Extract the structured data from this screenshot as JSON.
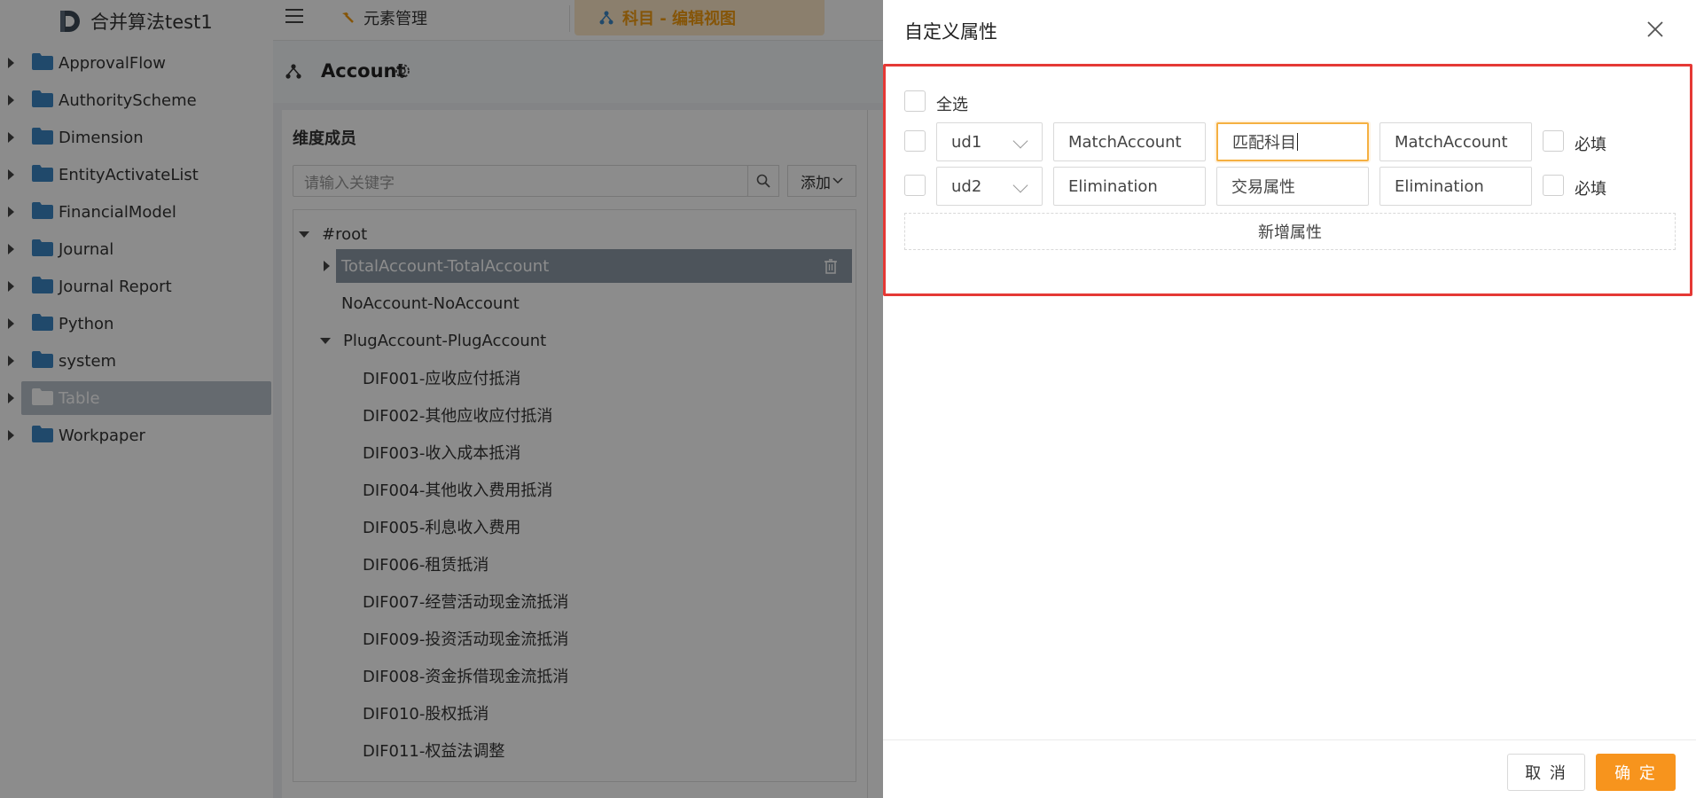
{
  "app": {
    "title": "合并算法test1"
  },
  "sidebar": {
    "items": [
      {
        "label": "ApprovalFlow"
      },
      {
        "label": "AuthorityScheme"
      },
      {
        "label": "Dimension"
      },
      {
        "label": "EntityActivateList"
      },
      {
        "label": "FinancialModel"
      },
      {
        "label": "Journal"
      },
      {
        "label": "Journal Report"
      },
      {
        "label": "Python"
      },
      {
        "label": "system"
      },
      {
        "label": "Table"
      },
      {
        "label": "Workpaper"
      }
    ],
    "selected": "Table"
  },
  "tabs": [
    {
      "label": "元素管理"
    },
    {
      "label": "科目 - 编辑视图"
    }
  ],
  "page": {
    "title": "Account"
  },
  "members": {
    "title": "维度成员",
    "search_placeholder": "请输入关键字",
    "add_label": "添加",
    "tree": [
      {
        "label": "#root"
      },
      {
        "label": "TotalAccount-TotalAccount"
      },
      {
        "label": "NoAccount-NoAccount"
      },
      {
        "label": "PlugAccount-PlugAccount"
      },
      {
        "label": "DIF001-应收应付抵消"
      },
      {
        "label": "DIF002-其他应收应付抵消"
      },
      {
        "label": "DIF003-收入成本抵消"
      },
      {
        "label": "DIF004-其他收入费用抵消"
      },
      {
        "label": "DIF005-利息收入费用"
      },
      {
        "label": "DIF006-租赁抵消"
      },
      {
        "label": "DIF007-经营活动现金流抵消"
      },
      {
        "label": "DIF009-投资活动现金流抵消"
      },
      {
        "label": "DIF008-资金拆借现金流抵消"
      },
      {
        "label": "DIF010-股权抵消"
      },
      {
        "label": "DIF011-权益法调整"
      }
    ]
  },
  "drawer": {
    "title": "自定义属性",
    "select_all_label": "全选",
    "rows": [
      {
        "type": "ud1",
        "name": "MatchAccount",
        "label": "匹配科目",
        "value": "MatchAccount",
        "required_label": "必填"
      },
      {
        "type": "ud2",
        "name": "Elimination",
        "label": "交易属性",
        "value": "Elimination",
        "required_label": "必填"
      }
    ],
    "add_attr_label": "新增属性",
    "cancel_label": "取 消",
    "ok_label": "确 定"
  },
  "colors": {
    "accent": "#f7941d",
    "highlight_border": "#e53935",
    "folder": "#3b86c4"
  }
}
